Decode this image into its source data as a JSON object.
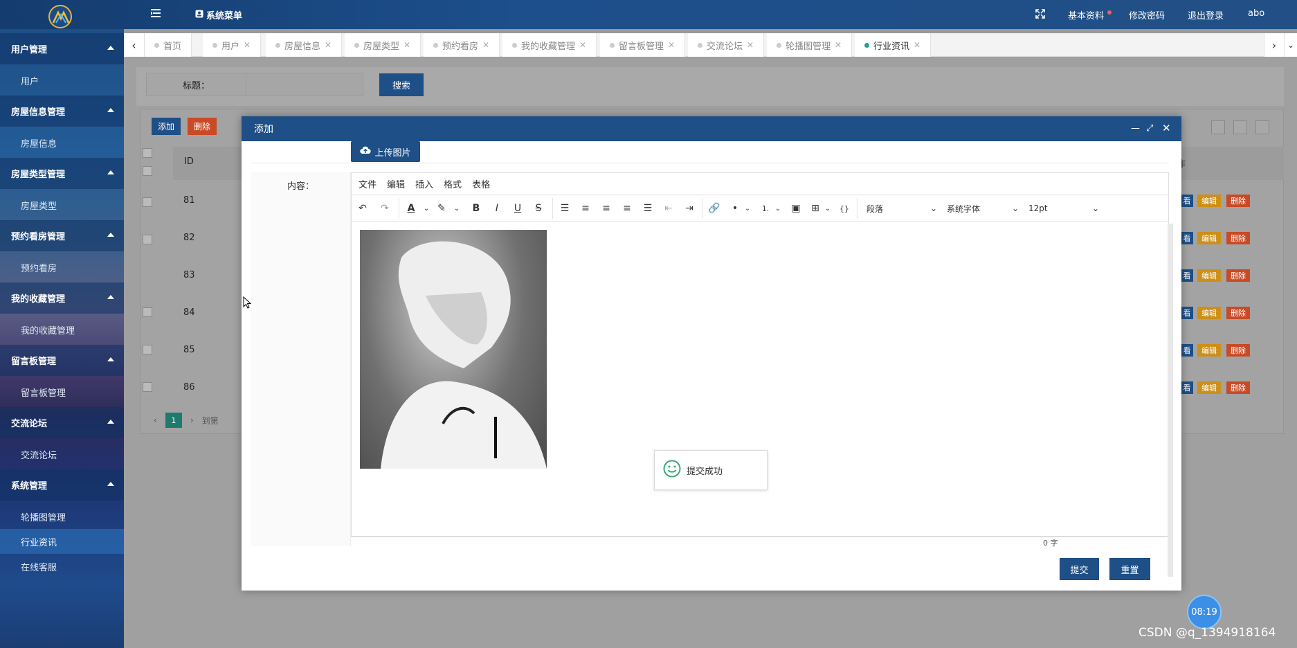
{
  "header": {
    "menu_title": "系统菜单",
    "basic_info": "基本资料",
    "change_password": "修改密码",
    "logout": "退出登录",
    "username": "abo"
  },
  "sidebar": {
    "groups": [
      {
        "label": "用户管理",
        "items": [
          "用户"
        ]
      },
      {
        "label": "房屋信息管理",
        "items": [
          "房屋信息"
        ]
      },
      {
        "label": "房屋类型管理",
        "items": [
          "房屋类型"
        ]
      },
      {
        "label": "预约看房管理",
        "items": [
          "预约看房"
        ]
      },
      {
        "label": "我的收藏管理",
        "items": [
          "我的收藏管理"
        ]
      },
      {
        "label": "留言板管理",
        "items": [
          "留言板管理"
        ]
      },
      {
        "label": "交流论坛",
        "items": [
          "交流论坛"
        ]
      },
      {
        "label": "系统管理",
        "items": [
          "轮播图管理",
          "行业资讯",
          "在线客服"
        ]
      }
    ]
  },
  "tabs": [
    "首页",
    "用户",
    "房屋信息",
    "房屋类型",
    "预约看房",
    "我的收藏管理",
    "留言板管理",
    "交流论坛",
    "轮播图管理",
    "行业资讯"
  ],
  "search": {
    "title_label": "标题：",
    "button": "搜索"
  },
  "table": {
    "add": "添加",
    "delete": "删除",
    "col_id": "ID",
    "col_op": "作",
    "rows": [
      "81",
      "82",
      "83",
      "84",
      "85",
      "86"
    ],
    "view": "看",
    "edit": "编辑",
    "del": "删除",
    "page": "1",
    "goto": "到第"
  },
  "modal": {
    "title": "添加",
    "upload_label": "上传图片",
    "content_label": "内容：",
    "menubar": [
      "文件",
      "编辑",
      "插入",
      "格式",
      "表格"
    ],
    "paragraph_select": "段落",
    "font_select": "系统字体",
    "size_select": "12pt",
    "word_count": "0 字",
    "toast": "提交成功",
    "submit": "提交",
    "reset": "重置"
  },
  "clock": "08:19",
  "watermark": "CSDN @q_1394918164",
  "colors": {
    "primary": "#1e4f86",
    "danger": "#c84a26",
    "warning": "#cc8f18",
    "active_tab_dot": "#2a9d8f"
  }
}
